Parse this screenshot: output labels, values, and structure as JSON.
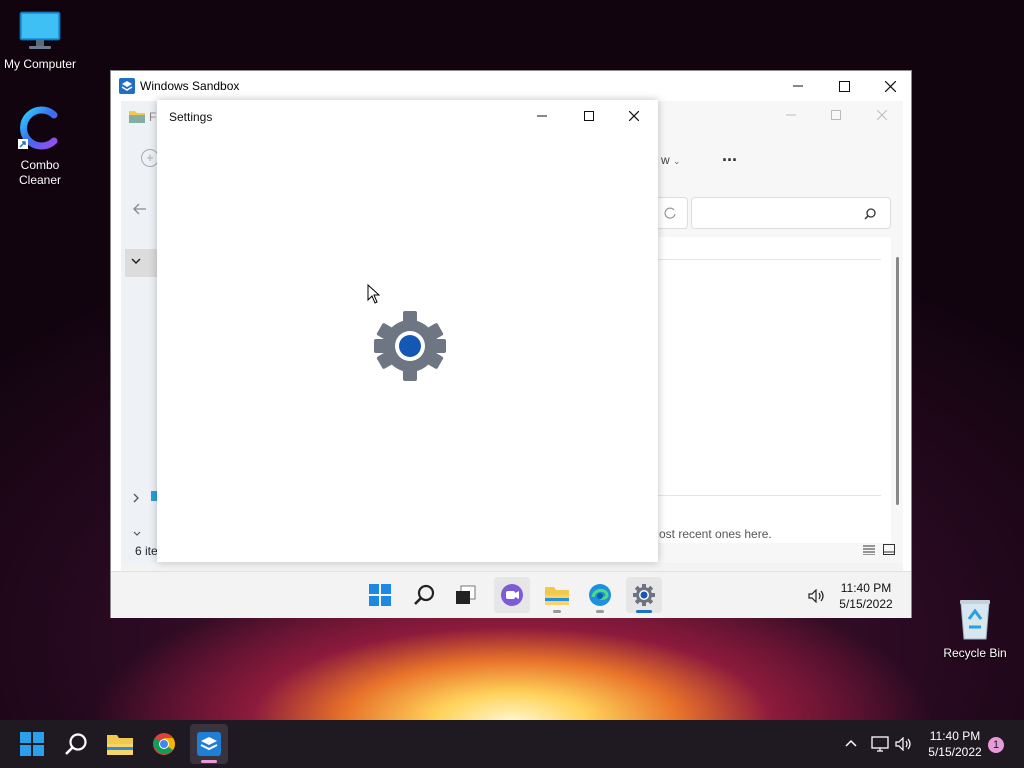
{
  "desktop": {
    "icons": [
      {
        "label": "My Computer",
        "icon": "monitor-icon"
      },
      {
        "label": "Combo\nCleaner",
        "icon": "combo-cleaner-icon"
      },
      {
        "label": "Recycle Bin",
        "icon": "recycle-bin-icon"
      }
    ]
  },
  "sandbox": {
    "title": "Windows Sandbox",
    "explorer": {
      "title_fragment": "Fi",
      "more_label": "...",
      "view_fragment": "w",
      "status_fragment": "6 ite",
      "hint_fragment": "ost recent ones here."
    },
    "settings": {
      "title": "Settings",
      "splash_icon": "gear-icon"
    },
    "taskbar": {
      "time": "11:40 PM",
      "date": "5/15/2022",
      "apps": [
        "start-icon",
        "search-icon",
        "task-view-icon",
        "chat-icon",
        "file-explorer-icon",
        "edge-icon",
        "settings-icon"
      ]
    }
  },
  "taskbar": {
    "time": "11:40 PM",
    "date": "5/15/2022",
    "notification_count": "1",
    "apps": [
      "start-icon",
      "search-icon",
      "file-explorer-icon",
      "chrome-icon",
      "sandbox-icon"
    ]
  },
  "colors": {
    "accent": "#1f6fc2",
    "taskbar_bg": "#1f1a22"
  }
}
